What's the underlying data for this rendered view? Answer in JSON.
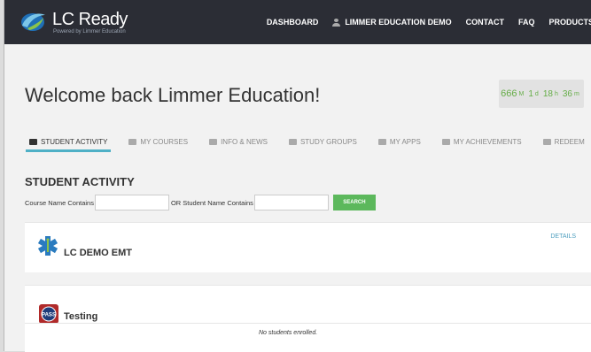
{
  "brand": {
    "name": "LC Ready",
    "tagline": "Powered by Limmer Education"
  },
  "nav": {
    "items": [
      {
        "label": "DASHBOARD"
      },
      {
        "label": "LIMMER EDUCATION DEMO"
      },
      {
        "label": "CONTACT"
      },
      {
        "label": "FAQ"
      },
      {
        "label": "PRODUCTS"
      }
    ]
  },
  "header": {
    "welcome": "Welcome back Limmer Education!",
    "countdown": {
      "months": "666",
      "months_unit": "M",
      "days": "1",
      "days_unit": "d",
      "hours": "18",
      "hours_unit": "h",
      "minutes": "36",
      "minutes_unit": "m"
    }
  },
  "tabs": [
    {
      "label": "STUDENT ACTIVITY",
      "active": true
    },
    {
      "label": "MY COURSES"
    },
    {
      "label": "INFO & NEWS"
    },
    {
      "label": "STUDY GROUPS"
    },
    {
      "label": "MY APPS"
    },
    {
      "label": "MY ACHIEVEMENTS"
    },
    {
      "label": "REDEEM"
    }
  ],
  "activity": {
    "title": "STUDENT ACTIVITY",
    "course_filter_label": "Course Name Contains",
    "student_filter_label": "OR Student Name Contains",
    "course_filter_value": "",
    "student_filter_value": "",
    "search_label": "SEARCH"
  },
  "courses": [
    {
      "name": "LC DEMO EMT",
      "details_label": "DETAILS"
    },
    {
      "name": "Testing",
      "empty_message": "No students enrolled."
    }
  ],
  "colors": {
    "navbar": "#2b2d35",
    "accent_tab": "#4fb0c6",
    "countdown_text": "#65ad47",
    "search_button": "#5cb85c",
    "link": "#4f9fbf"
  }
}
